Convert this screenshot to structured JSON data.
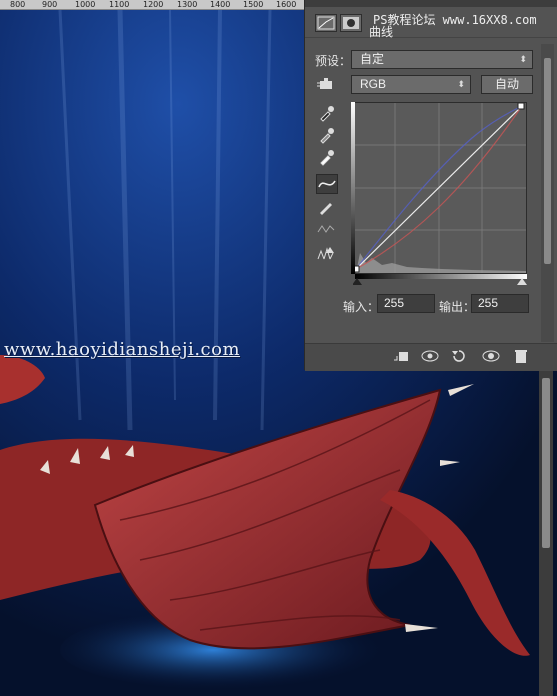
{
  "ruler": {
    "ticks": [
      "800",
      "900",
      "1000",
      "1100",
      "1200",
      "1300",
      "1400",
      "1500",
      "1600"
    ]
  },
  "canvas": {
    "watermark": "www.haoyidiansheji.com",
    "colors": {
      "background_top": "#0a2a66",
      "background_bottom": "#06142e",
      "dragon": "#9a2a2a"
    }
  },
  "panel": {
    "site_watermark": "PS教程论坛 www.16XX8.com",
    "title": "曲线",
    "preset_label": "预设：",
    "preset_value": "自定",
    "channel_value": "RGB",
    "auto_button": "自动",
    "input_label": "输入：",
    "input_value": "255",
    "output_label": "输出：",
    "output_value": "255",
    "tools": [
      "hand-adjust-icon",
      "black-eyedropper-icon",
      "gray-eyedropper-icon",
      "white-eyedropper-icon",
      "curve-point-icon",
      "pencil-icon",
      "smooth-icon",
      "clipping-warning-icon"
    ],
    "footer_icons": [
      "clip-to-layer-icon",
      "view-previous-icon",
      "reset-icon",
      "visibility-eye-icon",
      "trash-icon"
    ]
  }
}
